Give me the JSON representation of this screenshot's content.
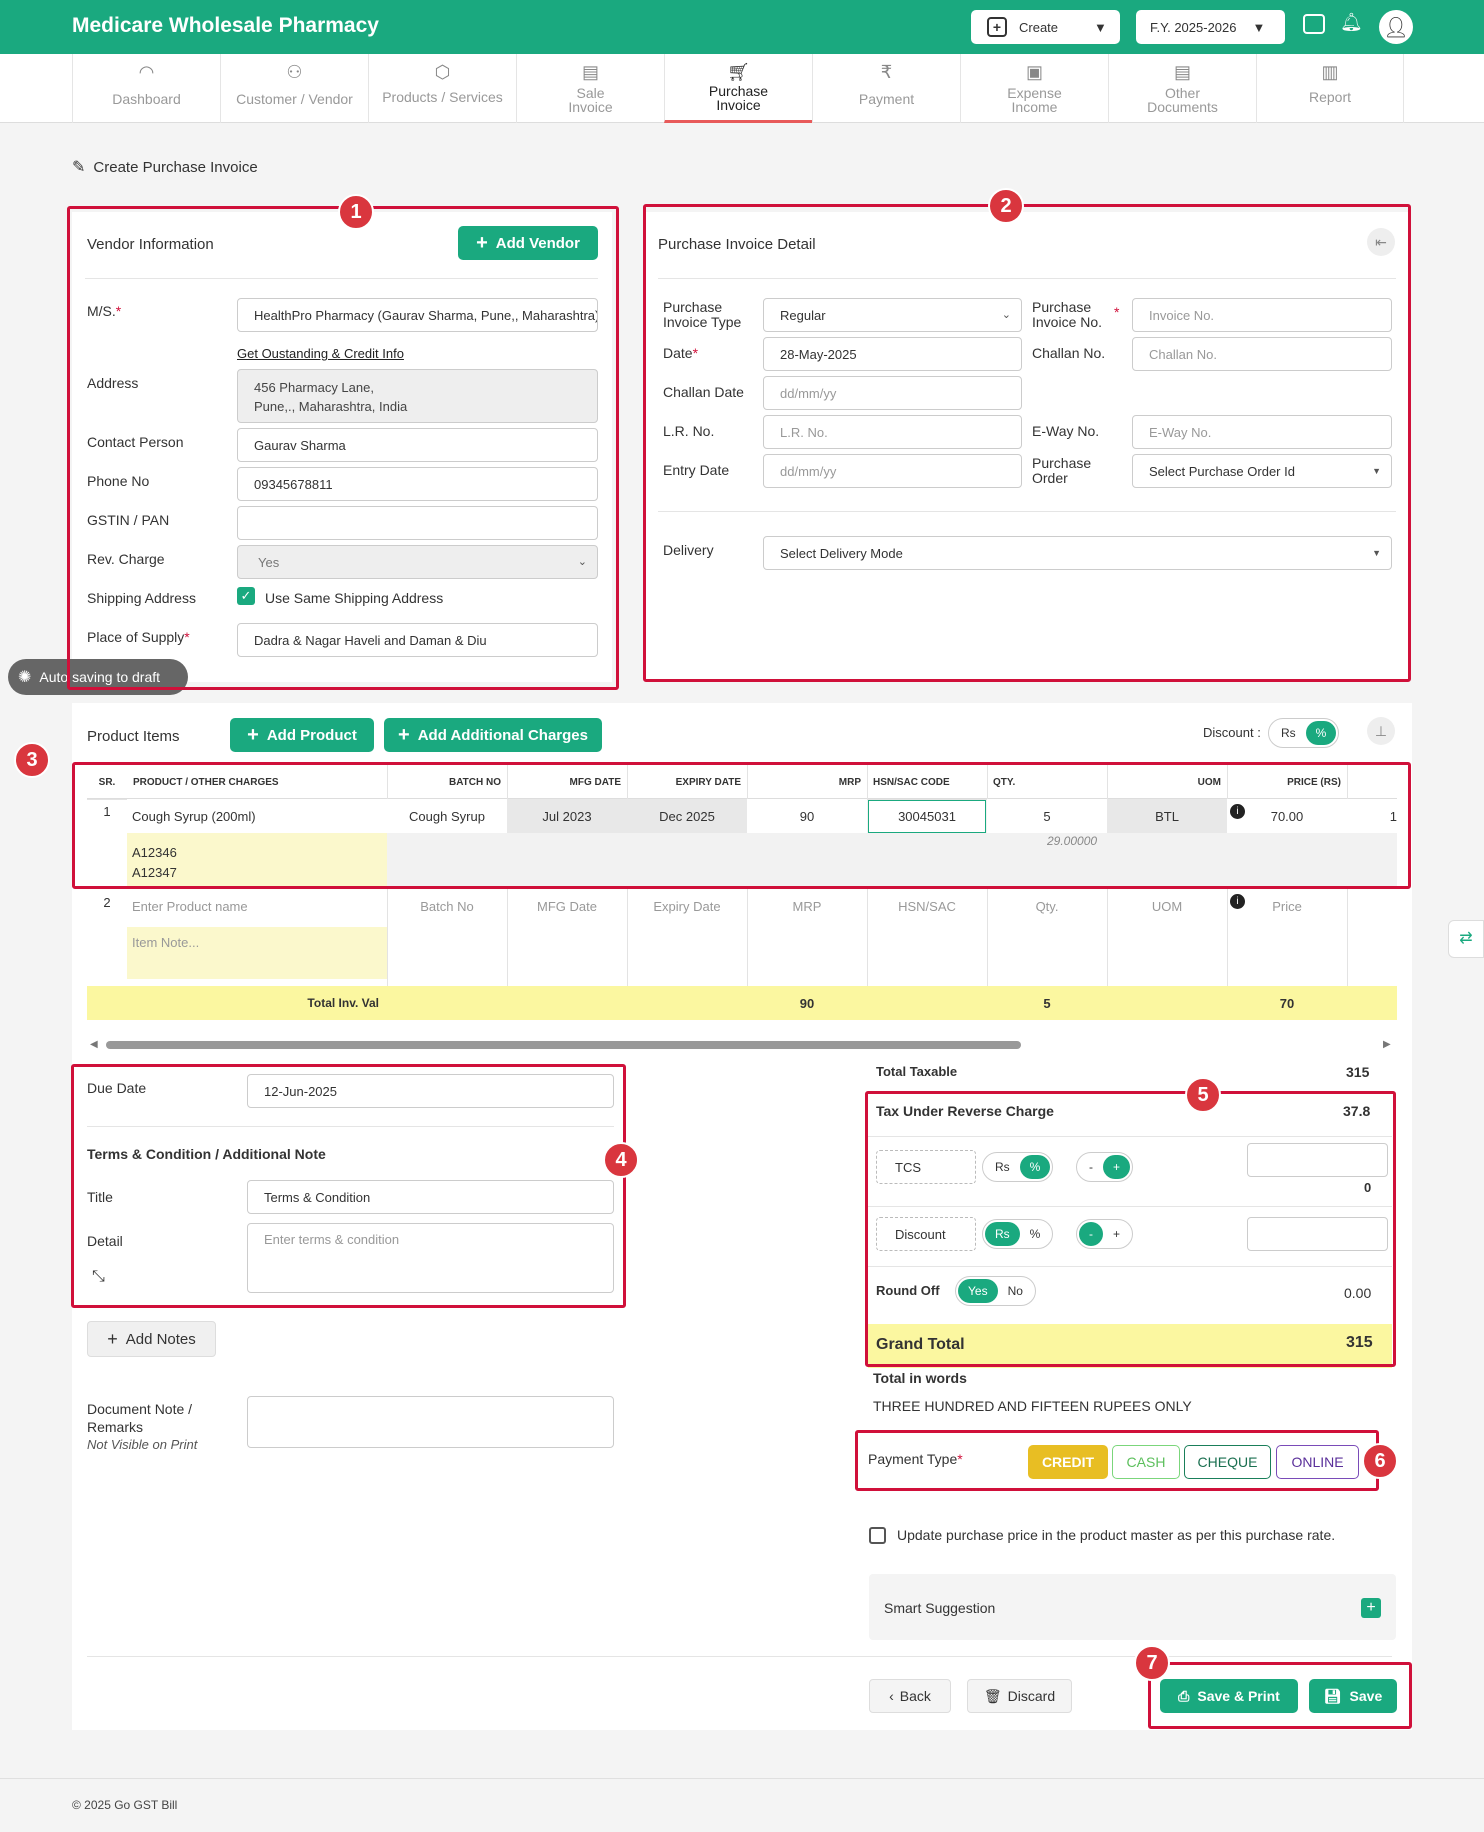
{
  "header": {
    "brand": "Medicare Wholesale Pharmacy",
    "create_label": "Create",
    "fy_label": "F.Y. 2025-2026"
  },
  "nav": [
    {
      "label": "Dashboard",
      "icon": "gauge-icon"
    },
    {
      "label": "Customer / Vendor",
      "icon": "users-icon"
    },
    {
      "label": "Products / Services",
      "icon": "box-icon"
    },
    {
      "label": "Sale Invoice",
      "icon": "document-icon"
    },
    {
      "label": "Purchase Invoice",
      "icon": "cart-icon"
    },
    {
      "label": "Payment",
      "icon": "rupee-icon"
    },
    {
      "label": "Expense Income",
      "icon": "expense-icon"
    },
    {
      "label": "Other Documents",
      "icon": "document-icon"
    },
    {
      "label": "Report",
      "icon": "report-icon"
    }
  ],
  "page_title": "Create Purchase Invoice",
  "vendor": {
    "heading": "Vendor Information",
    "add_vendor": "Add Vendor",
    "ms_label": "M/S.",
    "ms_value": "HealthPro Pharmacy (Gaurav Sharma, Pune,, Maharashtra)",
    "credit_link": "Get Oustanding & Credit Info",
    "address_label": "Address",
    "address_line1": "456 Pharmacy Lane,",
    "address_line2": "Pune,., Maharashtra, India",
    "contact_label": "Contact Person",
    "contact_value": "Gaurav Sharma",
    "phone_label": "Phone No",
    "phone_value": "09345678811",
    "gstin_label": "GSTIN / PAN",
    "gstin_value": "",
    "rev_label": "Rev. Charge",
    "rev_value": "Yes",
    "ship_label": "Shipping Address",
    "ship_check": "Use Same Shipping Address",
    "pos_label": "Place of Supply",
    "pos_value": "Dadra & Nagar Haveli and Daman & Diu"
  },
  "autosave": "Auto saving to draft",
  "invoice": {
    "heading": "Purchase Invoice Detail",
    "type_label1": "Purchase",
    "type_label2": "Invoice Type",
    "type_value": "Regular",
    "no_label1": "Purchase",
    "no_label2": "Invoice No.",
    "no_ph": "Invoice No.",
    "date_label": "Date",
    "date_value": "28-May-2025",
    "challan_no_label": "Challan No.",
    "challan_no_ph": "Challan No.",
    "challan_date_label": "Challan Date",
    "challan_date_ph": "dd/mm/yy",
    "lr_label": "L.R. No.",
    "lr_ph": "L.R. No.",
    "eway_label": "E-Way No.",
    "eway_ph": "E-Way No.",
    "entry_label": "Entry Date",
    "entry_ph": "dd/mm/yy",
    "po_label1": "Purchase",
    "po_label2": "Order",
    "po_ph": "Select Purchase Order Id",
    "delivery_label": "Delivery",
    "delivery_ph": "Select Delivery Mode"
  },
  "products": {
    "heading": "Product Items",
    "add_product": "Add Product",
    "add_charges": "Add Additional Charges",
    "discount_label": "Discount :",
    "disc_rs": "Rs",
    "disc_pct": "%",
    "columns": [
      "SR.",
      "PRODUCT / OTHER CHARGES",
      "BATCH NO",
      "MFG DATE",
      "EXPIRY DATE",
      "MRP",
      "HSN/SAC CODE",
      "QTY.",
      "UOM",
      "PRICE (RS)"
    ],
    "row1": {
      "sr": "1",
      "name": "Cough Syrup (200ml)",
      "batch": "Cough Syrup",
      "mfg": "Jul 2023",
      "expiry": "Dec 2025",
      "mrp": "90",
      "hsn": "30045031",
      "qty": "5",
      "qty_sub": "29.00000",
      "uom": "BTL",
      "price": "70.00",
      "note1": "A12346",
      "note2": "A12347",
      "cut": "1"
    },
    "row2": {
      "sr": "2",
      "name_ph": "Enter Product name",
      "batch_ph": "Batch No",
      "mfg_ph": "MFG Date",
      "exp_ph": "Expiry Date",
      "mrp_ph": "MRP",
      "hsn_ph": "HSN/SAC",
      "qty_ph": "Qty.",
      "uom_ph": "UOM",
      "price_ph": "Price",
      "note_ph": "Item Note..."
    },
    "total": {
      "label": "Total Inv. Val",
      "mrp": "90",
      "qty": "5",
      "price": "70"
    }
  },
  "terms": {
    "due_label": "Due Date",
    "due_value": "12-Jun-2025",
    "heading": "Terms & Condition / Additional Note",
    "title_label": "Title",
    "title_value": "Terms & Condition",
    "detail_label": "Detail",
    "detail_ph": "Enter terms & condition",
    "add_notes": "Add Notes",
    "doc_note_label1": "Document Note /",
    "doc_note_label2": "Remarks",
    "doc_note_sub": "Not Visible on Print"
  },
  "summary": {
    "taxable_label": "Total Taxable",
    "taxable_value": "315",
    "rcm_label": "Tax Under Reverse Charge",
    "rcm_value": "37.8",
    "tcs_label": "TCS",
    "tcs_value": "0",
    "discount_label": "Discount",
    "rs": "Rs",
    "pct": "%",
    "minus": "-",
    "plus": "+",
    "roundoff_label": "Round Off",
    "yes": "Yes",
    "no": "No",
    "roundoff_value": "0.00",
    "grand_label": "Grand Total",
    "grand_value": "315",
    "words_label": "Total in words",
    "words_value": "THREE HUNDRED AND FIFTEEN RUPEES ONLY"
  },
  "payment": {
    "label": "Payment Type",
    "credit": "CREDIT",
    "cash": "CASH",
    "cheque": "CHEQUE",
    "online": "ONLINE"
  },
  "update_price": "Update purchase price in the product master as per this purchase rate.",
  "smart_suggestion": "Smart Suggestion",
  "actions": {
    "back": "Back",
    "discard": "Discard",
    "save_print": "Save & Print",
    "save": "Save"
  },
  "badges": [
    "1",
    "2",
    "3",
    "4",
    "5",
    "6",
    "7"
  ],
  "footer": "© 2025 Go GST Bill",
  "colors": {
    "brand": "#1aa97f",
    "highlight_box": "#d0103a",
    "credit": "#e8be23",
    "online": "#7a4bb8"
  }
}
